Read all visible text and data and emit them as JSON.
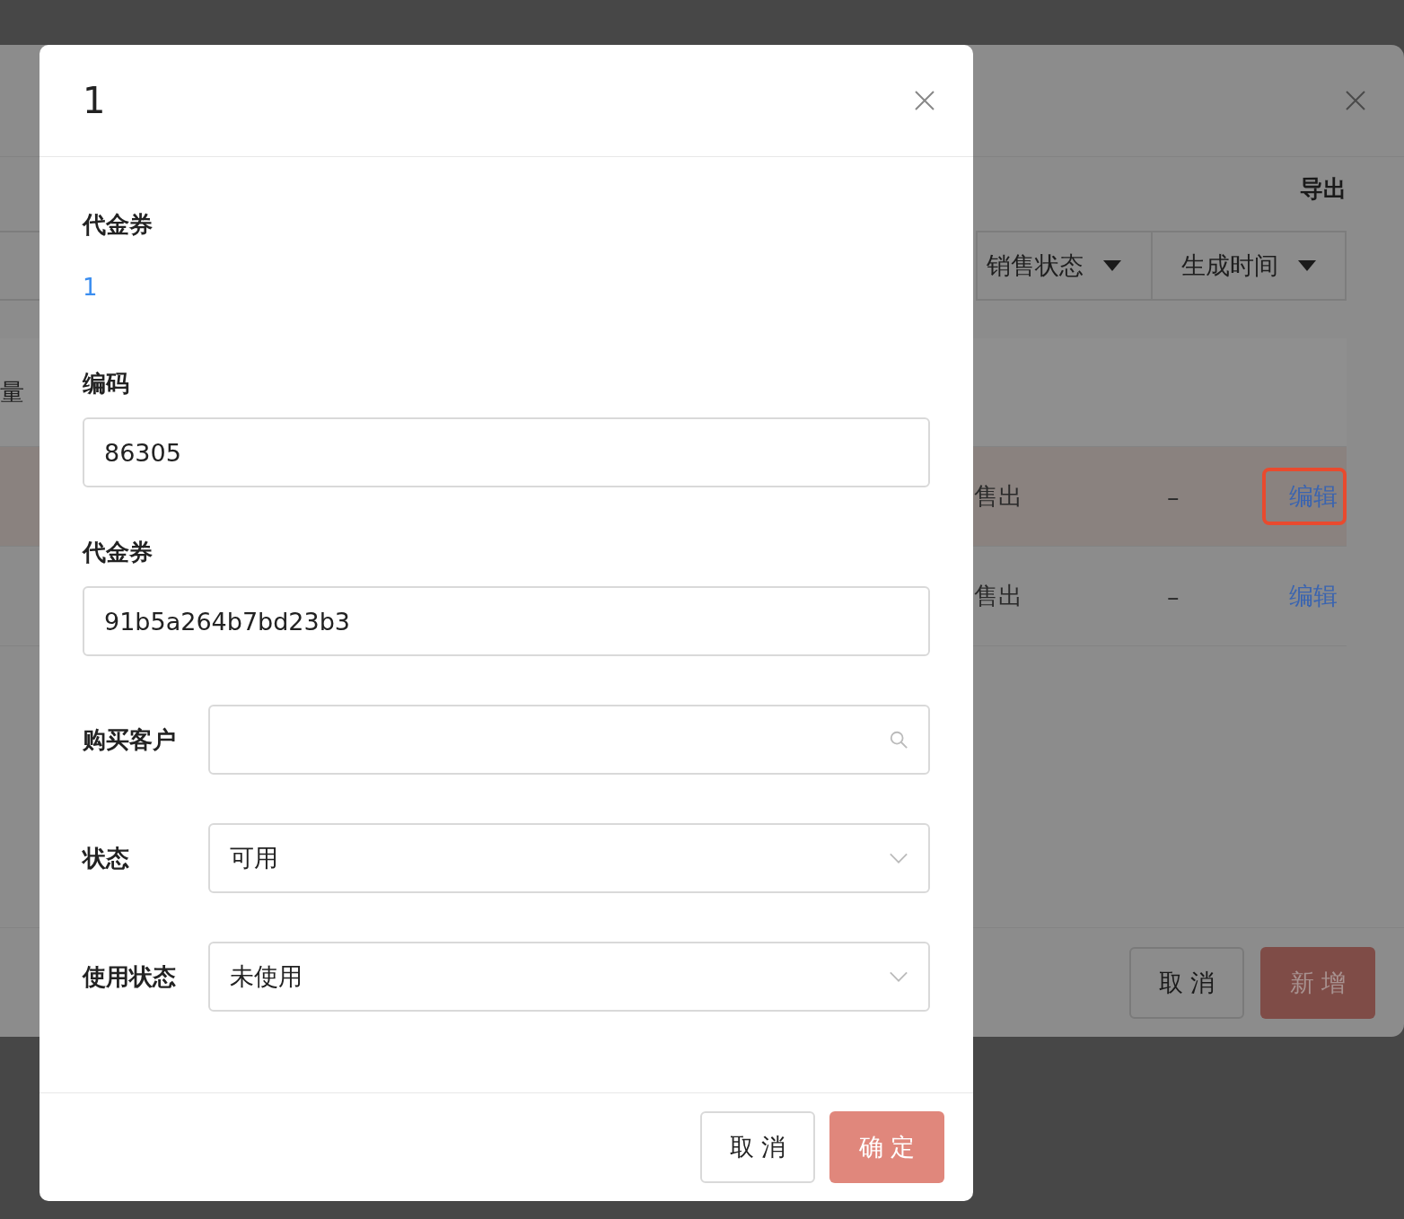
{
  "background_dialog": {
    "export_link": "导出",
    "header_fragment": "量",
    "filters": [
      {
        "label": "销售状态"
      },
      {
        "label": "生成时间"
      }
    ],
    "rows": [
      {
        "column_2": "售出",
        "column_3": "–",
        "action": "编辑",
        "selected": true
      },
      {
        "column_2": "售出",
        "column_3": "–",
        "action": "编辑",
        "selected": false
      }
    ],
    "buttons": [
      {
        "label": "取 消",
        "kind": "default"
      },
      {
        "label": "新 增",
        "kind": "primary"
      }
    ]
  },
  "dialog": {
    "title": "1",
    "fields": [
      {
        "kind": "link",
        "label": "代金券",
        "value": "1"
      },
      {
        "kind": "input",
        "label": "编码",
        "value": "86305"
      },
      {
        "kind": "input",
        "label": "代金券",
        "value": "91b5a264b7bd23b3"
      },
      {
        "kind": "search",
        "label": "购买客户"
      },
      {
        "kind": "select",
        "label": "状态",
        "value": "可用"
      },
      {
        "kind": "select",
        "label": "使用状态",
        "value": "未使用"
      }
    ],
    "buttons": [
      {
        "label": "取 消",
        "kind": "default"
      },
      {
        "label": "确 定",
        "kind": "primary"
      }
    ]
  }
}
